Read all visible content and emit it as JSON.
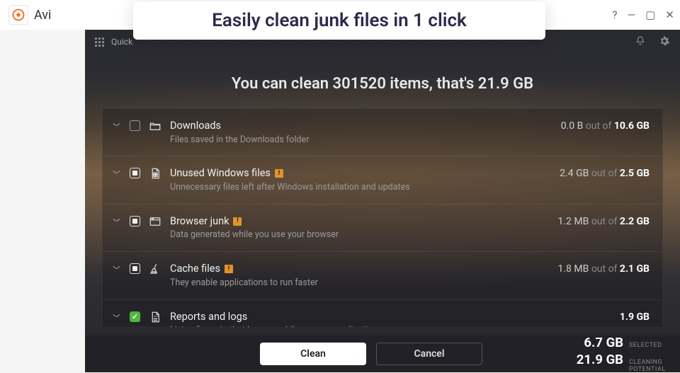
{
  "callout": "Easily clean junk files in 1 click",
  "brand_prefix": "Avi",
  "window_controls": {
    "help": "?",
    "min": "—",
    "max": "▢",
    "close": "✕"
  },
  "toolbar": {
    "quick": "Quick"
  },
  "headline": "You can clean 301520 items, that's 21.9 GB",
  "items": [
    {
      "title": "Downloads",
      "desc": "Files saved in the Downloads folder",
      "size_prefix": "0.0 B",
      "size_mid": " out of ",
      "size_total": "10.6 GB",
      "check": "empty",
      "warn": false,
      "icon": "folder"
    },
    {
      "title": "Unused Windows files",
      "desc": "Unnecessary files left after Windows installation and updates",
      "size_prefix": "2.4 GB",
      "size_mid": " out of ",
      "size_total": "2.5 GB",
      "check": "partial",
      "warn": true,
      "icon": "windows-file"
    },
    {
      "title": "Browser junk",
      "desc": "Data generated while you use your browser",
      "size_prefix": "1.2 MB",
      "size_mid": " out of ",
      "size_total": "2.2 GB",
      "check": "partial",
      "warn": true,
      "icon": "browser"
    },
    {
      "title": "Cache files",
      "desc": "They enable applications to run faster",
      "size_prefix": "1.8 MB",
      "size_mid": " out of ",
      "size_total": "2.1 GB",
      "check": "partial",
      "warn": true,
      "icon": "broom"
    },
    {
      "title": "Reports and logs",
      "desc": "Lists of events that happen while you use applications",
      "size_prefix": "",
      "size_mid": "",
      "size_total": "1.9 GB",
      "check": "full",
      "warn": false,
      "icon": "log"
    }
  ],
  "footer": {
    "clean": "Clean",
    "cancel": "Cancel",
    "selected_val": "6.7 GB",
    "selected_lbl": "SELECTED",
    "potential_val": "21.9 GB",
    "potential_lbl": "CLEANING POTENTIAL"
  }
}
